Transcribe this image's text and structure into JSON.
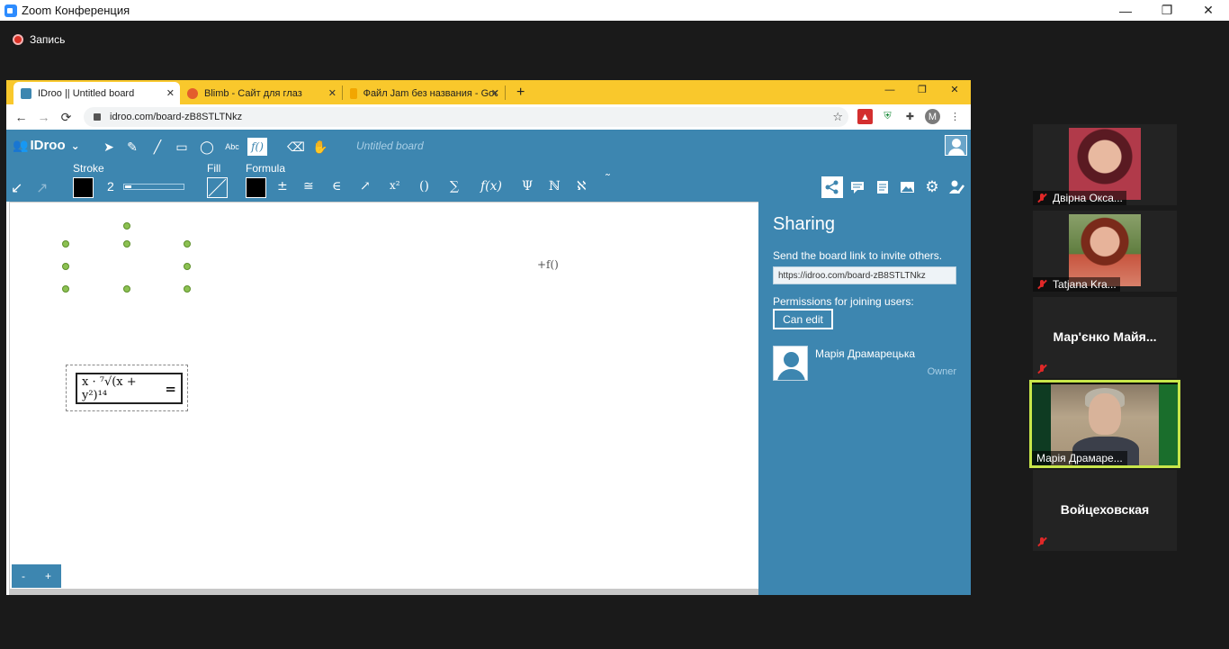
{
  "zoom": {
    "window_title": "Zoom Конференция",
    "recording_label": "Запись",
    "controls": {
      "minimize": "—",
      "restore": "❐",
      "close": "✕"
    }
  },
  "browser": {
    "tabs": [
      {
        "label": "IDroo || Untitled board",
        "close": "✕",
        "favicon_color": "#3d86b0"
      },
      {
        "label": "Blimb - Сайт для глаз",
        "close": "✕",
        "favicon_color": "#e35d2c"
      },
      {
        "label": "Файл Jam без названия - Goog",
        "close": "✕",
        "favicon_color": "#f2a600"
      }
    ],
    "new_tab": "+",
    "window_controls": {
      "minimize": "—",
      "restore": "❐",
      "close": "✕"
    },
    "nav": {
      "back": "←",
      "forward": "→",
      "reload": "⟳"
    },
    "url": "idroo.com/board-zB8STLTNkz",
    "star": "☆",
    "profile_letter": "M",
    "menu": "⋮"
  },
  "idroo": {
    "logo": "IDroo",
    "logo_caret": "⌄",
    "board_title": "Untitled board",
    "tools": {
      "select": "➤",
      "pencil": "✎",
      "line": "╱",
      "rectangle": "▭",
      "ellipse": "◯",
      "text": "Abc",
      "formula": "f()",
      "eraser": "⌫",
      "hand": "✋"
    },
    "props": {
      "stroke_label": "Stroke",
      "stroke_value": "2",
      "stroke_fraction": 0.1,
      "fill_label": "Fill",
      "formula_label": "Formula"
    },
    "symbols": [
      "±",
      "≅",
      "∈",
      "↗",
      "x²",
      "()",
      "∑",
      "f(x)",
      "Ψ",
      "ℕ",
      "ℵ",
      "˜"
    ],
    "undo_icon": "↙",
    "redo_icon": "↗",
    "right_tools": [
      "share",
      "chat",
      "document",
      "image",
      "settings",
      "user-edit"
    ],
    "formula": {
      "lhs": "x · ⁷√(x + y²)¹⁴",
      "eq": "="
    },
    "cursor_label": "+f()",
    "zoom_minus": "-",
    "zoom_plus": "+"
  },
  "sharing": {
    "title": "Sharing",
    "invite_text": "Send the board link to invite others.",
    "link": "https://idroo.com/board-zB8STLTNkz",
    "permissions_label": "Permissions for joining users:",
    "permission_value": "Can edit",
    "user_name": "Марія Драмарецька",
    "user_role": "Owner"
  },
  "participants": [
    {
      "name": "Двірна Окса...",
      "muted": true,
      "has_photo": true,
      "photo_color": "#b13a4a"
    },
    {
      "name": "Tatjana  Kra...",
      "muted": true,
      "has_photo": true,
      "photo_color": "#c7543e"
    },
    {
      "name": "Мар'єнко  Майя...",
      "muted": true,
      "has_photo": false
    },
    {
      "name": "Марія Драмаре...",
      "muted": false,
      "active": true
    },
    {
      "name": "Войцеховская",
      "muted": true,
      "has_photo": false
    }
  ],
  "colors": {
    "idroo_blue": "#3d86b0",
    "browser_frame": "#f9c82c",
    "active_speaker": "#c8e64a",
    "zoom_bg": "#1a1a1a"
  }
}
